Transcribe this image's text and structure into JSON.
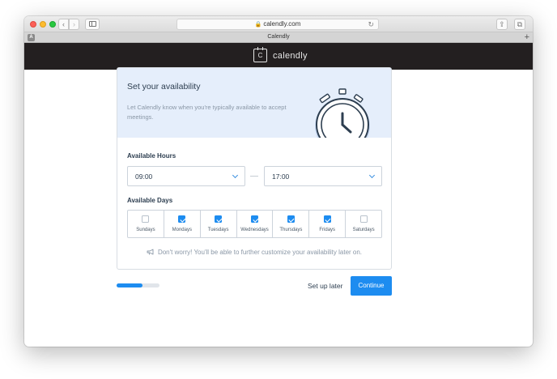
{
  "browser": {
    "url": "calendly.com",
    "tab_title": "Calendly",
    "tab_pin_letter": "A",
    "tab_add": "+",
    "back": "‹",
    "forward": "›",
    "lock": "🔒",
    "reload": "↻",
    "share": "⇪",
    "tabs": "⧉"
  },
  "header": {
    "logo_mark": "C",
    "logo_text": "calendly"
  },
  "hero": {
    "title": "Set your availability",
    "subtitle": "Let Calendly know when you're typically available to accept meetings."
  },
  "hours": {
    "label": "Available Hours",
    "start": "09:00",
    "end": "17:00"
  },
  "days": {
    "label": "Available Days",
    "items": [
      {
        "name": "Sundays",
        "checked": false
      },
      {
        "name": "Mondays",
        "checked": true
      },
      {
        "name": "Tuesdays",
        "checked": true
      },
      {
        "name": "Wednesdays",
        "checked": true
      },
      {
        "name": "Thursdays",
        "checked": true
      },
      {
        "name": "Fridays",
        "checked": true
      },
      {
        "name": "Saturdays",
        "checked": false
      }
    ]
  },
  "note": "Don't worry! You'll be able to further customize your availability later on.",
  "footer": {
    "progress": 0.6,
    "setup_later": "Set up later",
    "continue": "Continue"
  },
  "colors": {
    "accent": "#1d8cf0",
    "header_bg": "#231f20",
    "hero_bg": "#e5eefb"
  }
}
